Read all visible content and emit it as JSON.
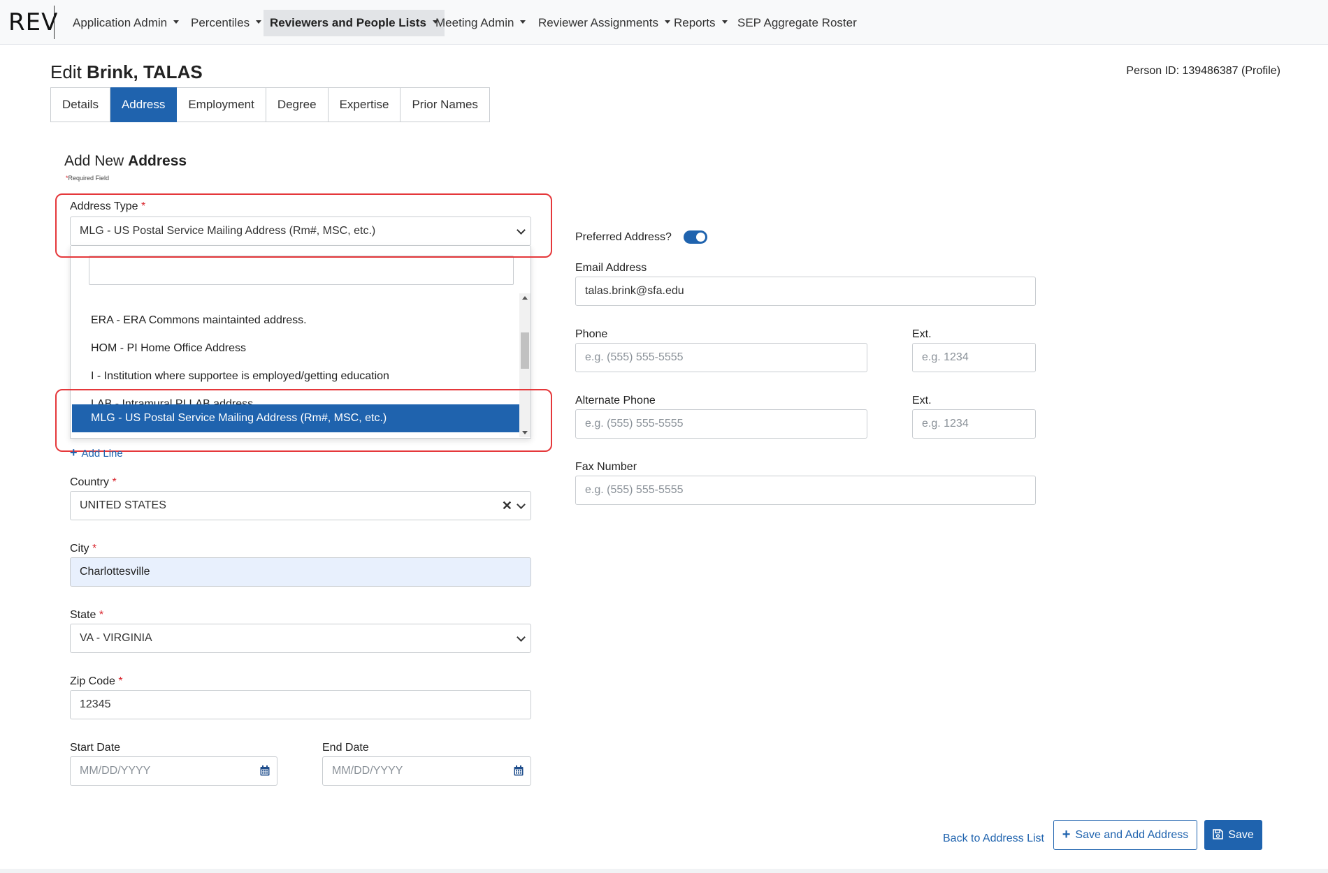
{
  "nav": {
    "brand": "REV",
    "items": [
      {
        "label": "Application Admin"
      },
      {
        "label": "Percentiles"
      },
      {
        "label": "Reviewers and People Lists"
      },
      {
        "label": "Meeting Admin"
      },
      {
        "label": "Reviewer Assignments"
      },
      {
        "label": "Reports"
      },
      {
        "label": "SEP Aggregate Roster"
      }
    ]
  },
  "header": {
    "edit_prefix": "Edit",
    "person_name": "Brink, TALAS",
    "person_id": "Person ID: 139486387 (Profile)"
  },
  "tabs": [
    {
      "label": "Details"
    },
    {
      "label": "Address"
    },
    {
      "label": "Employment"
    },
    {
      "label": "Degree"
    },
    {
      "label": "Expertise"
    },
    {
      "label": "Prior Names"
    }
  ],
  "form": {
    "title_prefix": "Add New",
    "title_bold": "Address",
    "required_mark": "*",
    "required_note": "Required Field",
    "address_type": {
      "label": "Address Type",
      "value": "MLG - US Postal Service Mailing Address (Rm#, MSC, etc.)"
    },
    "dropdown": {
      "search_value": "",
      "options": [
        "ERA - ERA Commons maintainted address.",
        "HOM - PI Home Office Address",
        "I - Institution where supportee is employed/getting education",
        "LAB - Intramural PI LAB address",
        "MLG - US Postal Service Mailing Address (Rm#, MSC, etc.)"
      ]
    },
    "add_line": {
      "icon": "+",
      "label": "Add Line"
    },
    "country": {
      "label": "Country",
      "value": "UNITED STATES",
      "clear_icon": "✕"
    },
    "city": {
      "label": "City",
      "value": "Charlottesville"
    },
    "state": {
      "label": "State",
      "value": "VA - VIRGINIA"
    },
    "zip": {
      "label": "Zip Code",
      "value": "12345"
    },
    "start_date": {
      "label": "Start Date",
      "placeholder": "MM/DD/YYYY"
    },
    "end_date": {
      "label": "End Date",
      "placeholder": "MM/DD/YYYY"
    },
    "preferred": {
      "label": "Preferred Address?",
      "on": true
    },
    "email": {
      "label": "Email Address",
      "value": "talas.brink@sfa.edu"
    },
    "phone": {
      "label": "Phone",
      "placeholder": "e.g. (555) 555-5555"
    },
    "phone_ext": {
      "label": "Ext.",
      "placeholder": "e.g. 1234"
    },
    "alt_phone": {
      "label": "Alternate Phone",
      "placeholder": "e.g. (555) 555-5555"
    },
    "alt_ext": {
      "label": "Ext.",
      "placeholder": "e.g. 1234"
    },
    "fax": {
      "label": "Fax Number",
      "placeholder": "e.g. (555) 555-5555"
    }
  },
  "actions": {
    "back": "Back to Address List",
    "save_add": "Save and Add Address",
    "save_add_icon": "+",
    "save": "Save"
  },
  "colors": {
    "primary": "#1f63ae",
    "highlight": "#e5383b",
    "required": "#d9262e"
  }
}
